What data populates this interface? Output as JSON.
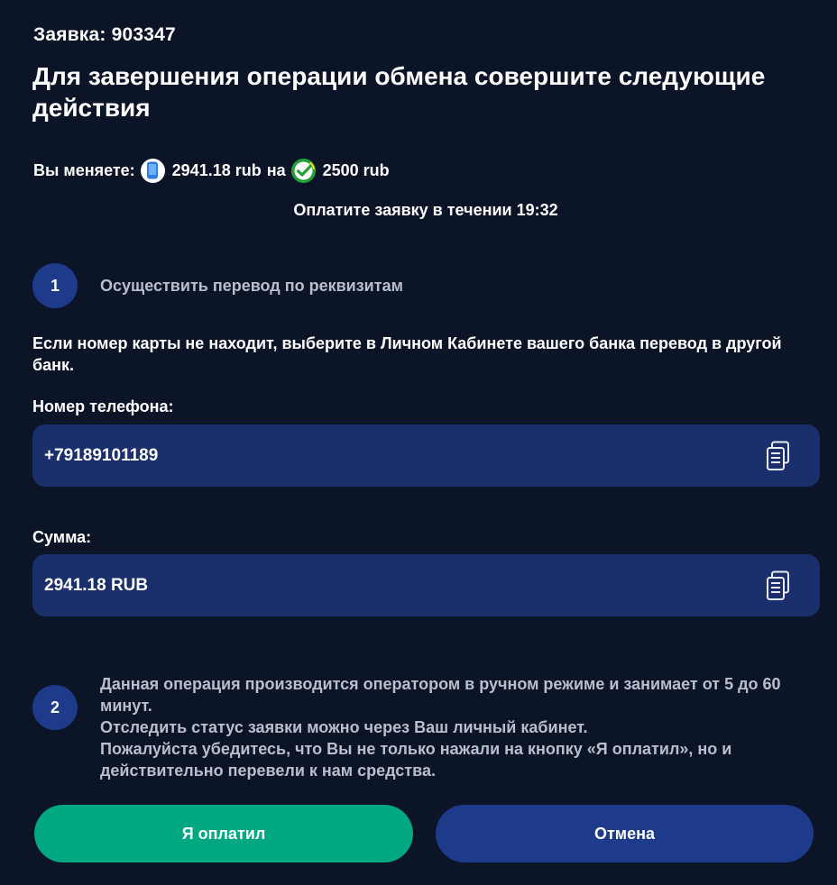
{
  "header": {
    "order_label": "Заявка: 903347",
    "title": "Для завершения операции обмена совершите следующие действия"
  },
  "exchange": {
    "prefix": "Вы меняете:",
    "from_amount": "2941.18 rub",
    "connector": "на",
    "to_amount": "2500 rub",
    "from_icon": "phone-payment-icon",
    "to_icon": "checkmark-bank-icon"
  },
  "timer": {
    "text": "Оплатите заявку в течении 19:32"
  },
  "step1": {
    "number": "1",
    "text": "Осуществить перевод по реквизитам"
  },
  "notice": "Если номер карты не находит, выберите в Личном Кабинете вашего банка перевод в другой банк.",
  "phone_field": {
    "label": "Номер телефона:",
    "value": "+79189101189"
  },
  "amount_field": {
    "label": "Сумма:",
    "value": "2941.18 RUB"
  },
  "step2": {
    "number": "2",
    "line1": "Данная операция производится оператором в ручном режиме и занимает от 5 до 60 минут.",
    "line2": "Отследить статус заявки можно через Ваш личный кабинет.",
    "line3": "Пожалуйста убедитесь, что Вы не только нажали на кнопку «Я оплатил», но и действительно перевели к нам средства."
  },
  "buttons": {
    "paid_label": "Я оплатил",
    "cancel_label": "Отмена"
  },
  "colors": {
    "background": "#0c1427",
    "field_bg": "#1a2f6b",
    "badge_bg": "#1e3a8a",
    "paid_button": "#00a882",
    "cancel_button": "#1e3a8a",
    "muted_text": "#b8bfcc"
  }
}
